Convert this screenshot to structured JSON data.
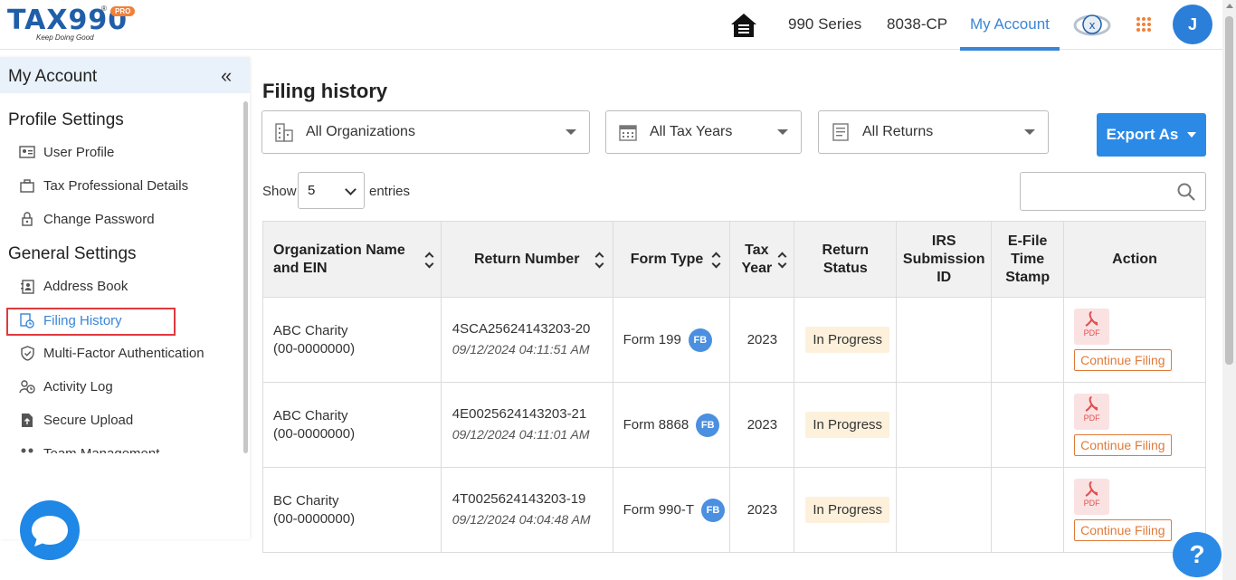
{
  "brand": {
    "name": "TAX990",
    "registered": "®",
    "badge": "PRO",
    "tagline": "Keep Doing Good"
  },
  "topnav": {
    "items": [
      {
        "label": "990 Series"
      },
      {
        "label": "8038-CP"
      },
      {
        "label": "My Account",
        "active": true
      }
    ],
    "avatar_initial": "J"
  },
  "sidebar": {
    "title": "My Account",
    "collapse_glyph": "«",
    "sections": [
      {
        "title": "Profile Settings",
        "items": [
          {
            "label": "User Profile",
            "icon": "id-card-icon"
          },
          {
            "label": "Tax Professional Details",
            "icon": "briefcase-icon"
          },
          {
            "label": "Change Password",
            "icon": "lock-icon"
          }
        ]
      },
      {
        "title": "General Settings",
        "items": [
          {
            "label": "Address Book",
            "icon": "address-book-icon"
          },
          {
            "label": "Filing History",
            "icon": "history-icon",
            "active": true
          },
          {
            "label": "Multi-Factor Authentication",
            "icon": "shield-icon"
          },
          {
            "label": "Activity Log",
            "icon": "activity-icon"
          },
          {
            "label": "Secure Upload",
            "icon": "upload-file-icon"
          },
          {
            "label": "Team Management",
            "icon": "team-icon"
          }
        ]
      }
    ]
  },
  "page": {
    "title": "Filing history",
    "filters": {
      "organizations": "All Organizations",
      "tax_years": "All Tax Years",
      "returns": "All Returns"
    },
    "export_label": "Export As",
    "show_label": "Show",
    "entries_value": "5",
    "entries_label": "entries",
    "search_placeholder": ""
  },
  "table": {
    "headers": {
      "org": [
        "Organization Name",
        "and EIN"
      ],
      "return_number": "Return Number",
      "form_type": "Form Type",
      "tax_year": [
        "Tax",
        "Year"
      ],
      "return_status": [
        "Return",
        "Status"
      ],
      "irs_id": [
        "IRS",
        "Submission",
        "ID"
      ],
      "efile": [
        "E-File",
        "Time",
        "Stamp"
      ],
      "action": "Action"
    },
    "rows": [
      {
        "org": "ABC Charity",
        "ein": "(00-0000000)",
        "return_number": "4SCA25624143203-20",
        "timestamp": "09/12/2024 04:11:51 AM",
        "form": "Form 199",
        "form_badge": "FB",
        "year": "2023",
        "status": "In Progress",
        "pdf": "PDF",
        "action": "Continue Filing"
      },
      {
        "org": "ABC Charity",
        "ein": "(00-0000000)",
        "return_number": "4E0025624143203-21",
        "timestamp": "09/12/2024 04:11:01 AM",
        "form": "Form 8868",
        "form_badge": "FB",
        "year": "2023",
        "status": "In Progress",
        "pdf": "PDF",
        "action": "Continue Filing"
      },
      {
        "org": "BC Charity",
        "ein": "(00-0000000)",
        "return_number": "4T0025624143203-19",
        "timestamp": "09/12/2024 04:04:48 AM",
        "form": "Form 990-T",
        "form_badge": "FB",
        "year": "2023",
        "status": "In Progress",
        "pdf": "PDF",
        "action": "Continue Filing"
      }
    ]
  },
  "help_glyph": "?"
}
